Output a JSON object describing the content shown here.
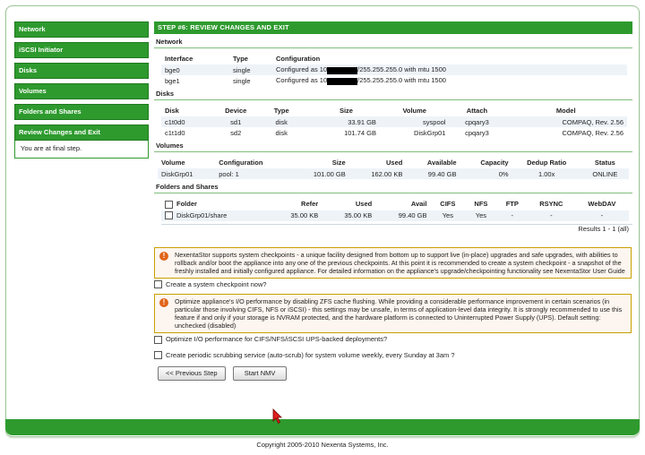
{
  "sidebar": {
    "items": [
      {
        "label": "Network"
      },
      {
        "label": "iSCSI Initiator"
      },
      {
        "label": "Disks"
      },
      {
        "label": "Volumes"
      },
      {
        "label": "Folders and Shares"
      },
      {
        "label": "Review Changes and Exit"
      }
    ],
    "note": "You are at final step."
  },
  "step_title": "STEP #6: REVIEW CHANGES AND EXIT",
  "network": {
    "title": "Network",
    "headers": [
      "Interface",
      "Type",
      "Configuration"
    ],
    "rows": [
      {
        "iface": "bge0",
        "type": "single",
        "conf_a": "Configured as 10",
        "conf_b": "/255.255.255.0 with mtu 1500"
      },
      {
        "iface": "bge1",
        "type": "single",
        "conf_a": "Configured as 10",
        "conf_b": "/255.255.255.0 with mtu 1500"
      }
    ]
  },
  "disks": {
    "title": "Disks",
    "headers": [
      "Disk",
      "Device",
      "Type",
      "Size",
      "Volume",
      "Attach",
      "Model"
    ],
    "rows": [
      [
        "c1t0d0",
        "sd1",
        "disk",
        "33.91 GB",
        "syspool",
        "cpqary3",
        "COMPAQ, Rev. 2.56"
      ],
      [
        "c1t1d0",
        "sd2",
        "disk",
        "101.74 GB",
        "DiskGrp01",
        "cpqary3",
        "COMPAQ, Rev. 2.56"
      ]
    ]
  },
  "volumes": {
    "title": "Volumes",
    "headers": [
      "Volume",
      "Configuration",
      "Size",
      "Used",
      "Available",
      "Capacity",
      "Dedup Ratio",
      "Status"
    ],
    "rows": [
      [
        "DiskGrp01",
        "pool: 1",
        "101.00 GB",
        "162.00 KB",
        "99.40 GB",
        "0%",
        "1.00x",
        "ONLINE"
      ]
    ]
  },
  "folders": {
    "title": "Folders and Shares",
    "headers": [
      "Folder",
      "Refer",
      "Used",
      "Avail",
      "CIFS",
      "NFS",
      "FTP",
      "RSYNC",
      "WebDAV"
    ],
    "rows": [
      [
        "DiskGrp01/share",
        "35.00 KB",
        "35.00 KB",
        "99.40 GB",
        "Yes",
        "Yes",
        "-",
        "-",
        "-"
      ]
    ],
    "results": "Results 1 - 1 (all)"
  },
  "checkpoint": {
    "text": "NexentaStor supports system checkpoints - a unique facility designed from bottom up to support live (in-place) upgrades and safe upgrades, with abilities to rollback and/or boot the appliance into any one of the previous checkpoints. At this point it is recommended to create a system checkpoint - a snapshot of the freshly installed and initially configured appliance. For detailed information on the appliance's upgrade/checkpointing functionality see NexentaStor User Guide",
    "option": "Create a system checkpoint now?"
  },
  "zfs": {
    "text": "Optimize appliance's I/O performance by disabling ZFS cache flushing. While providing a considerable performance improvement in certain scenarios (in particular those involving CIFS, NFS or iSCSI) - this settings may be unsafe, in terms of application-level data integrity. It is strongly recommended to use this feature if and only if your storage is NVRAM protected, and the hardware platform is connected to Uninterrupted Power Supply (UPS). Default setting: unchecked (disabled)",
    "option": "Optimize I/O performance for CIFS/NFS/iSCSI UPS-backed deployments?"
  },
  "scrub_option": "Create periodic scrubbing service (auto-scrub) for system volume weekly, every Sunday at 3am ?",
  "buttons": {
    "prev": "<< Previous Step",
    "start": "Start NMV"
  },
  "footer": "Copyright 2005-2010 Nexenta Systems, Inc.",
  "colors": {
    "brand_green": "#2e9a2e",
    "alert_border": "#c8a000",
    "alert_icon": "#e06418"
  }
}
